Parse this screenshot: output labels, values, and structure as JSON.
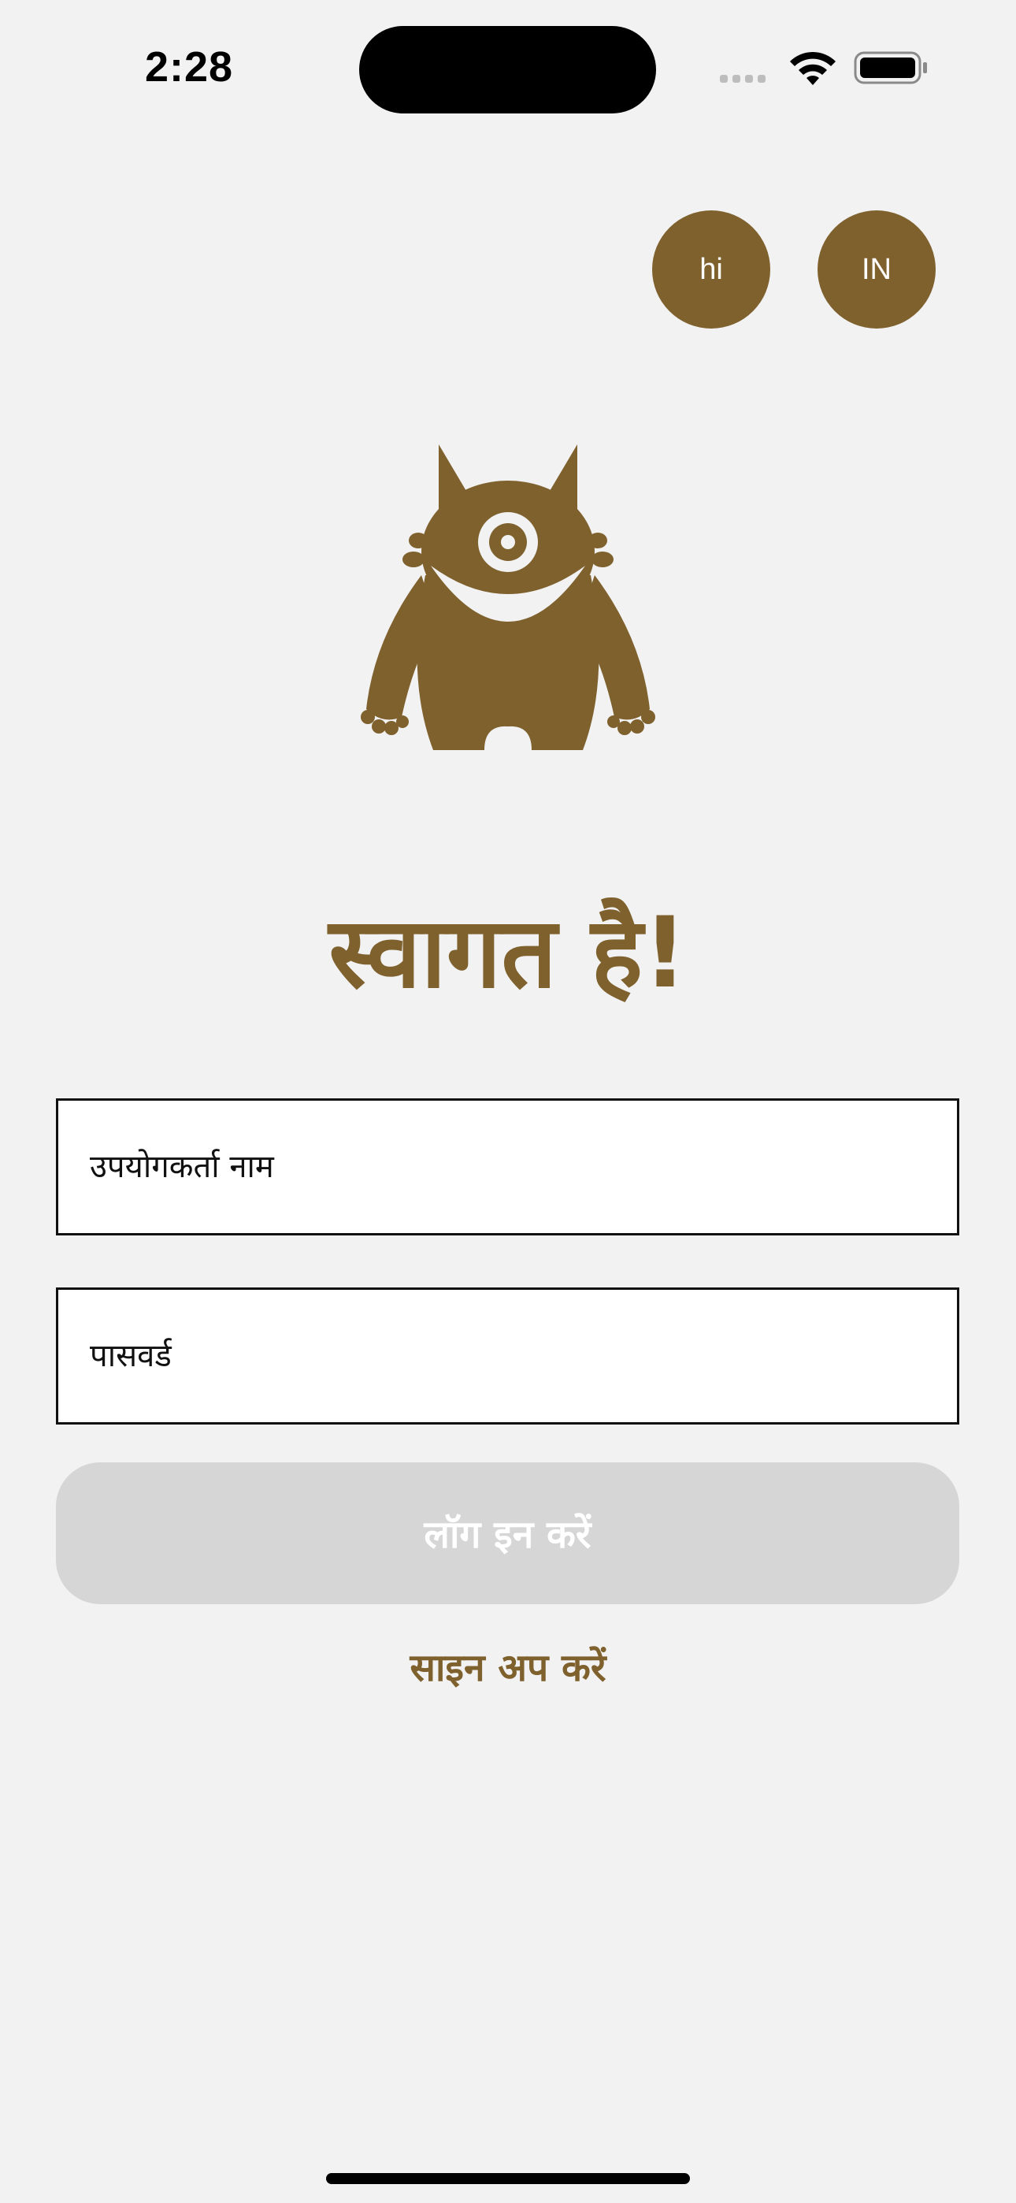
{
  "status_bar": {
    "time": "2:28"
  },
  "locale": {
    "language_label": "hi",
    "region_label": "IN"
  },
  "welcome": {
    "title": "स्वागत है!"
  },
  "form": {
    "username_placeholder": "उपयोगकर्ता नाम",
    "password_placeholder": "पासवर्ड",
    "login_label": "लॉग इन करें",
    "signup_label": "साइन अप करें"
  },
  "colors": {
    "brand": "#7f612e",
    "background": "#f2f2f2",
    "button_disabled": "#d6d6d6"
  },
  "icons": {
    "mascot": "monster-mascot-icon",
    "wifi": "wifi-icon",
    "battery": "battery-icon"
  }
}
